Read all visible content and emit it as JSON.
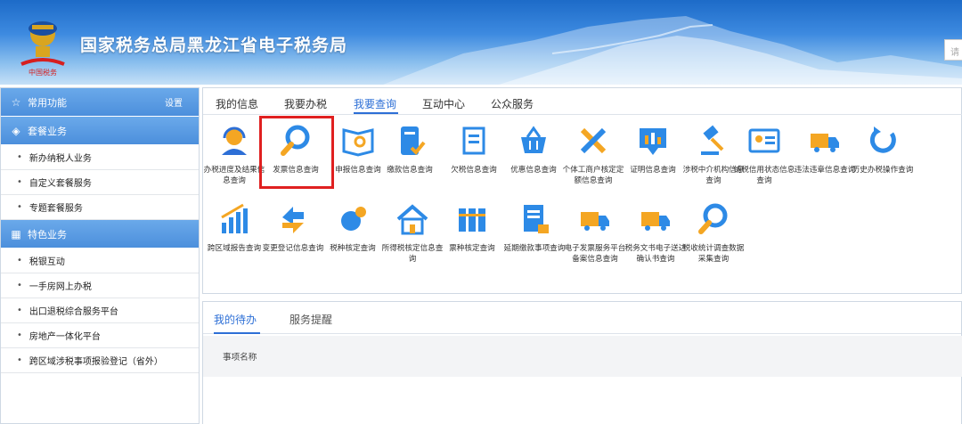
{
  "header": {
    "title": "国家税务总局黑龙江省电子税务局",
    "search_placeholder": "请"
  },
  "sidebar": {
    "sections": [
      {
        "label": "常用功能",
        "icon": "star-icon",
        "extra": "设置",
        "items": []
      },
      {
        "label": "套餐业务",
        "icon": "layers-icon",
        "items": [
          "新办纳税人业务",
          "自定义套餐服务",
          "专题套餐服务"
        ]
      },
      {
        "label": "特色业务",
        "icon": "grid-icon",
        "items": [
          "税银互动",
          "一手房网上办税",
          "出口退税综合服务平台",
          "房地产一体化平台",
          "跨区域涉税事项报验登记（省外）"
        ]
      }
    ]
  },
  "main": {
    "tabs": [
      "我的信息",
      "我要办税",
      "我要查询",
      "互动中心",
      "公众服务"
    ],
    "active_tab": "我要查询",
    "row1": [
      {
        "icon": "headset-icon",
        "label": "办税进度及结果信息查询"
      },
      {
        "icon": "magnifier-icon",
        "label": "发票信息查询"
      },
      {
        "icon": "book-search-icon",
        "label": "申报信息查询"
      },
      {
        "icon": "payment-doc-icon",
        "label": "缴款信息查询"
      },
      {
        "icon": "overdue-doc-icon",
        "label": "欠税信息查询"
      },
      {
        "icon": "basket-icon",
        "label": "优惠信息查询"
      },
      {
        "icon": "tools-icon",
        "label": "个体工商户核定定额信息查询"
      },
      {
        "icon": "certificate-icon",
        "label": "证明信息查询"
      },
      {
        "icon": "gavel-icon",
        "label": "涉税中介机构信息查询"
      },
      {
        "icon": "id-card-icon",
        "label": "纳税信用状态信息查询"
      },
      {
        "icon": "truck-icon",
        "label": "违法违章信息查询"
      },
      {
        "icon": "history-icon",
        "label": "历史办税操作查询"
      }
    ],
    "row2": [
      {
        "icon": "bar-chart-icon",
        "label": "跨区域报告查询"
      },
      {
        "icon": "exchange-icon",
        "label": "变更登记信息查询"
      },
      {
        "icon": "tax-type-icon",
        "label": "税种核定查询"
      },
      {
        "icon": "house-icon",
        "label": "所得税核定信息查询"
      },
      {
        "icon": "binders-icon",
        "label": "票种核定查询"
      },
      {
        "icon": "deferred-doc-icon",
        "label": "延期缴款事项查询"
      },
      {
        "icon": "invoice-truck-icon",
        "label": "电子发票服务平台备案信息查询"
      },
      {
        "icon": "doc-truck-icon",
        "label": "税务文书电子送达确认书查询"
      },
      {
        "icon": "survey-search-icon",
        "label": "税收统计调查数据采集查询"
      }
    ]
  },
  "todo": {
    "tabs": [
      "我的待办",
      "服务提醒"
    ],
    "column": "事项名称"
  }
}
